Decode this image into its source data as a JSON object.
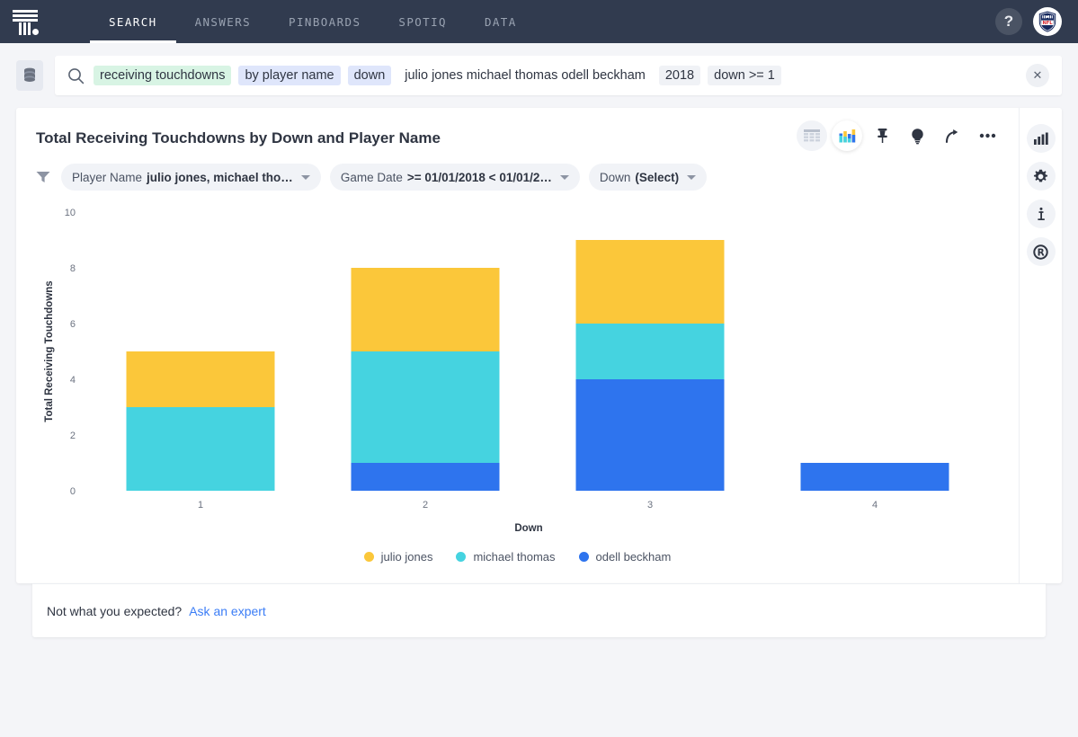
{
  "header": {
    "logo_name": "thoughtspot-logo",
    "nav": [
      {
        "label": "SEARCH",
        "active": true
      },
      {
        "label": "ANSWERS",
        "active": false
      },
      {
        "label": "PINBOARDS",
        "active": false
      },
      {
        "label": "SPOTIQ",
        "active": false
      },
      {
        "label": "DATA",
        "active": false
      }
    ],
    "help_label": "?",
    "avatar_label": "NFL"
  },
  "search": {
    "source_icon": "database-icon",
    "search_icon": "search-icon",
    "clear_label": "✕",
    "tokens": [
      {
        "text": "receiving touchdowns",
        "style": "measure"
      },
      {
        "text": "by player name",
        "style": "attr"
      },
      {
        "text": "down",
        "style": "attr"
      },
      {
        "text": "julio jones michael thomas odell beckham",
        "style": "bare"
      },
      {
        "text": "2018",
        "style": "plain"
      },
      {
        "text": "down >= 1",
        "style": "plain"
      }
    ]
  },
  "viz": {
    "title": "Total Receiving Touchdowns by Down and Player Name",
    "tools": [
      {
        "name": "table-view-icon",
        "active": false
      },
      {
        "name": "chart-view-icon",
        "active": true
      },
      {
        "name": "pin-icon",
        "active": false
      },
      {
        "name": "spotiq-lightbulb-icon",
        "active": false
      },
      {
        "name": "share-icon",
        "active": false
      },
      {
        "name": "more-options-icon",
        "active": false
      }
    ],
    "filter_icon": "filter-icon",
    "chips": [
      {
        "label": "Player Name",
        "value": "julio jones, michael tho…",
        "has_caret": true
      },
      {
        "label": "Game Date",
        "value": ">= 01/01/2018 < 01/01/2…",
        "has_caret": true
      },
      {
        "label": "Down",
        "value": "(Select)",
        "has_caret": true
      }
    ]
  },
  "rail": [
    {
      "name": "chart-config-icon",
      "label": "chart"
    },
    {
      "name": "gear-icon",
      "label": "settings"
    },
    {
      "name": "info-icon",
      "label": "info"
    },
    {
      "name": "r-analysis-icon",
      "label": "r-analysis"
    }
  ],
  "footer": {
    "prompt": "Not what you expected?",
    "link": "Ask an expert"
  },
  "chart_data": {
    "type": "bar",
    "stacked": true,
    "title": "Total Receiving Touchdowns by Down and Player Name",
    "xlabel": "Down",
    "ylabel": "Total Receiving Touchdowns",
    "categories": [
      "1",
      "2",
      "3",
      "4"
    ],
    "ylim": [
      0,
      10
    ],
    "yticks": [
      0,
      2,
      4,
      6,
      8,
      10
    ],
    "grid": false,
    "legend_position": "bottom",
    "series": [
      {
        "name": "julio jones",
        "color": "#FBC73A",
        "values": [
          2,
          3,
          3,
          0
        ]
      },
      {
        "name": "michael thomas",
        "color": "#45D3E0",
        "values": [
          3,
          4,
          2,
          0
        ]
      },
      {
        "name": "odell beckham",
        "color": "#2E74EE",
        "values": [
          0,
          1,
          4,
          1
        ]
      }
    ],
    "totals": [
      5,
      8,
      9,
      1
    ]
  }
}
